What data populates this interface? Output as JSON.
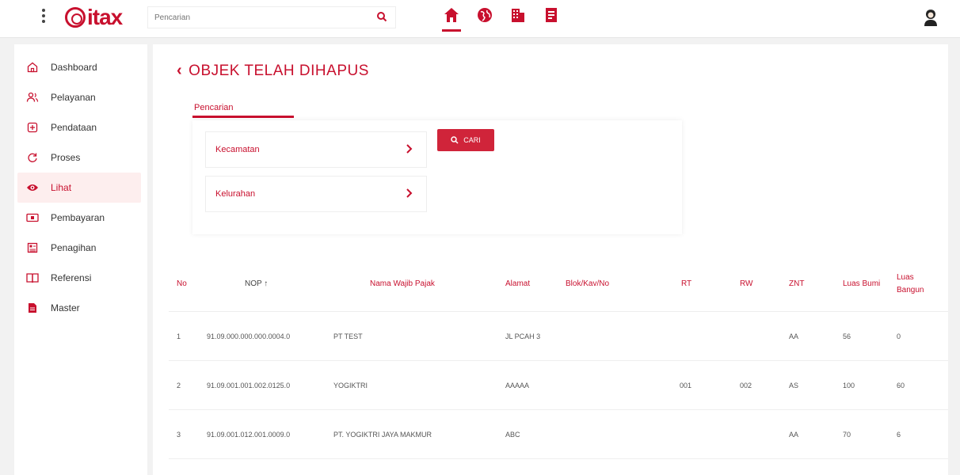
{
  "header": {
    "logo_text": "itax",
    "search_placeholder": "Pencarian",
    "nav_icons": [
      "home-icon",
      "globe-icon",
      "building-icon",
      "document-icon"
    ],
    "accent": "#c8102e"
  },
  "sidebar": {
    "items": [
      {
        "label": "Dashboard",
        "icon": "home-outline-icon"
      },
      {
        "label": "Pelayanan",
        "icon": "users-icon"
      },
      {
        "label": "Pendataan",
        "icon": "add-box-icon"
      },
      {
        "label": "Proses",
        "icon": "refresh-icon"
      },
      {
        "label": "Lihat",
        "icon": "eye-icon",
        "active": true
      },
      {
        "label": "Pembayaran",
        "icon": "cash-icon"
      },
      {
        "label": "Penagihan",
        "icon": "invoice-icon"
      },
      {
        "label": "Referensi",
        "icon": "book-icon"
      },
      {
        "label": "Master",
        "icon": "file-icon"
      }
    ]
  },
  "main": {
    "title": "OBJEK TELAH DIHAPUS",
    "tab_label": "Pencarian",
    "filters": {
      "kecamatan": "Kecamatan",
      "kelurahan": "Kelurahan",
      "search_button": "CARI"
    },
    "table": {
      "headers": {
        "no": "No",
        "nop": "NOP ↑",
        "nama": "Nama Wajib Pajak",
        "alamat": "Alamat",
        "blok": "Blok/Kav/No",
        "rt": "RT",
        "rw": "RW",
        "znt": "ZNT",
        "luas_bumi": "Luas Bumi",
        "luas_bangunan": "Luas Bangun"
      },
      "rows": [
        {
          "no": "1",
          "nop": "91.09.000.000.000.0004.0",
          "nama": "PT TEST",
          "alamat": "JL PCAH 3",
          "blok": "",
          "rt": "",
          "rw": "",
          "znt": "AA",
          "luas_bumi": "56",
          "luas_bangunan": "0"
        },
        {
          "no": "2",
          "nop": "91.09.001.001.002.0125.0",
          "nama": "YOGIKTRI",
          "alamat": "AAAAA",
          "blok": "",
          "rt": "001",
          "rw": "002",
          "znt": "AS",
          "luas_bumi": "100",
          "luas_bangunan": "60"
        },
        {
          "no": "3",
          "nop": "91.09.001.012.001.0009.0",
          "nama": "PT. YOGIKTRI JAYA MAKMUR",
          "alamat": "ABC",
          "blok": "",
          "rt": "",
          "rw": "",
          "znt": "AA",
          "luas_bumi": "70",
          "luas_bangunan": "6"
        }
      ]
    }
  }
}
